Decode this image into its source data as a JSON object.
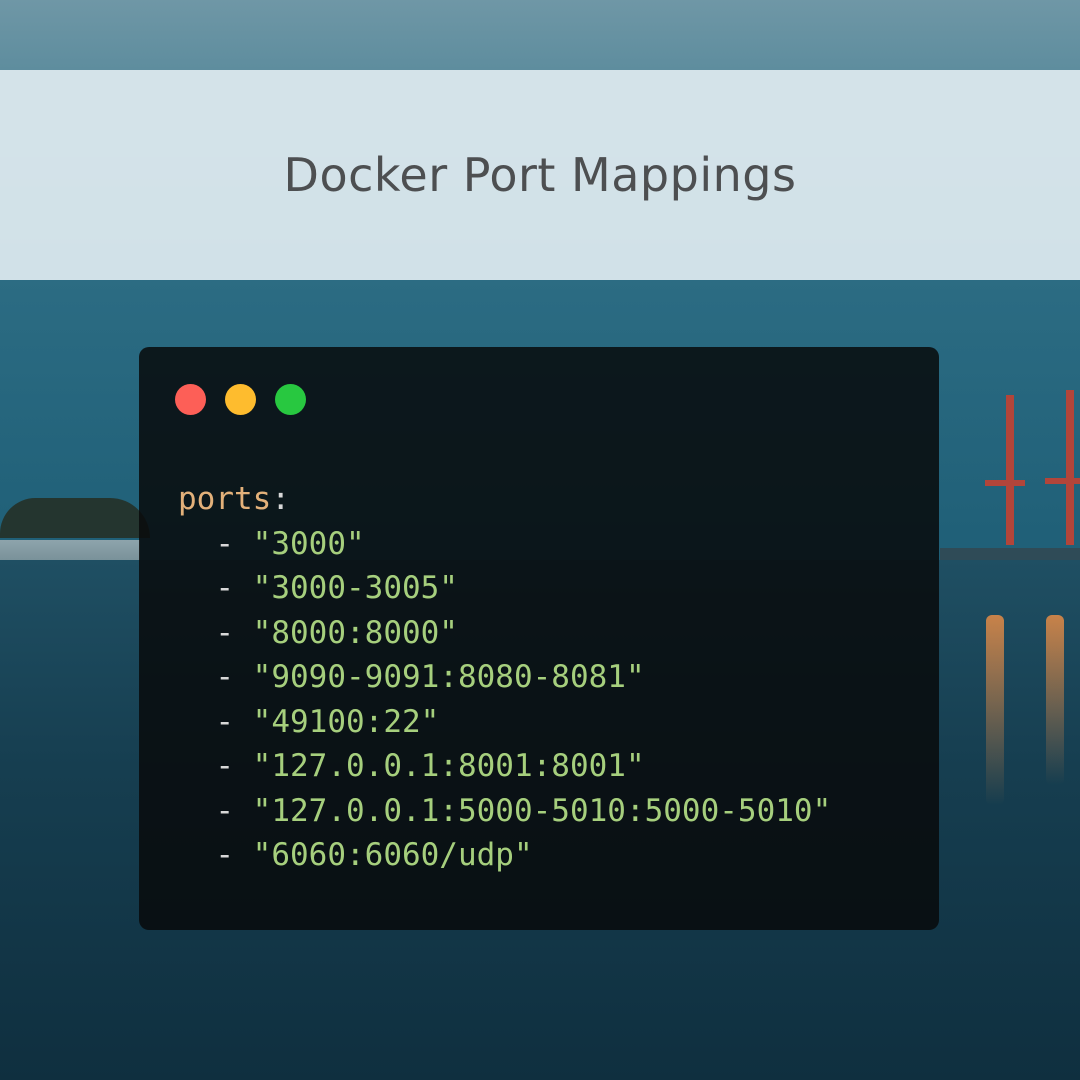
{
  "title": "Docker Port Mappings",
  "window": {
    "controls": [
      "close-button",
      "minimize-button",
      "maximize-button"
    ],
    "colors": {
      "close": "#fd5f57",
      "minimize": "#febc2e",
      "maximize": "#28c840",
      "key": "#e3b17a",
      "string": "#a6cf7d"
    }
  },
  "code": {
    "key": "ports",
    "colon": ":",
    "dash": "-",
    "items": [
      "\"3000\"",
      "\"3000-3005\"",
      "\"8000:8000\"",
      "\"9090-9091:8080-8081\"",
      "\"49100:22\"",
      "\"127.0.0.1:8001:8001\"",
      "\"127.0.0.1:5000-5010:5000-5010\"",
      "\"6060:6060/udp\""
    ]
  }
}
